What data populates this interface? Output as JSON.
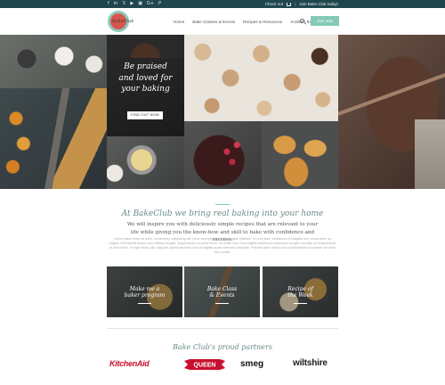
{
  "topbar": {
    "social": [
      "f",
      "in",
      "𝕏",
      "▶",
      "▣",
      "G+",
      "P"
    ],
    "checkout_label": "Check out",
    "join_label": "Join Bake Club today!"
  },
  "header": {
    "logo_text": "BakeClub",
    "nav": [
      "Home",
      "Bake Classes & Events",
      "Recipes & Resources",
      "Annika's Books"
    ],
    "join_button": "Join now"
  },
  "hero": {
    "title_lines": [
      "Be praised",
      "and loved for",
      "your baking"
    ],
    "button_label": "FIND OUT NOW"
  },
  "intro": {
    "title": "At BakeClub we bring real baking into your home",
    "subtitle": "We will inspire you with deliciously simple recipes that are relevant to your life while giving you the know-how and skill to bake with confidence and success.",
    "body": "Lorem ipsum dolor sit amet, consectetur adipiscing elit. Nunc suscipit erat eget convallis molestie. Ut erat dolor, vestibulum eu sagittis non, consectetur ac magna. Sed blandit dictum arcu efficitur feugiat. Suspendisse eu porta lorem, eu mollis erat. Duis sagittis vestibulum bibendum mi eget convallis vel suspendisse et urna lorem. In eget tellus odio. Aliquam lacinia tincidunt nunc id sagittis quam interdum vulputate. Pulvinar amet lectus arcu condimentum accumsan vel amet non ornare."
  },
  "cards": [
    {
      "label_lines": [
        "Make me a",
        "baker program"
      ]
    },
    {
      "label_lines": [
        "Bake Class",
        "& Events"
      ]
    },
    {
      "label_lines": [
        "Recipe of",
        "the Week"
      ]
    }
  ],
  "partners": {
    "title": "Bake Club's proud partners",
    "logos": [
      "KitchenAid",
      "QUEEN",
      "smeg",
      "wiltshire"
    ]
  },
  "colors": {
    "topbar": "#20464d",
    "accent": "#86c9b6",
    "kitchenaid": "#c8102e",
    "queen": "#c8102e"
  }
}
